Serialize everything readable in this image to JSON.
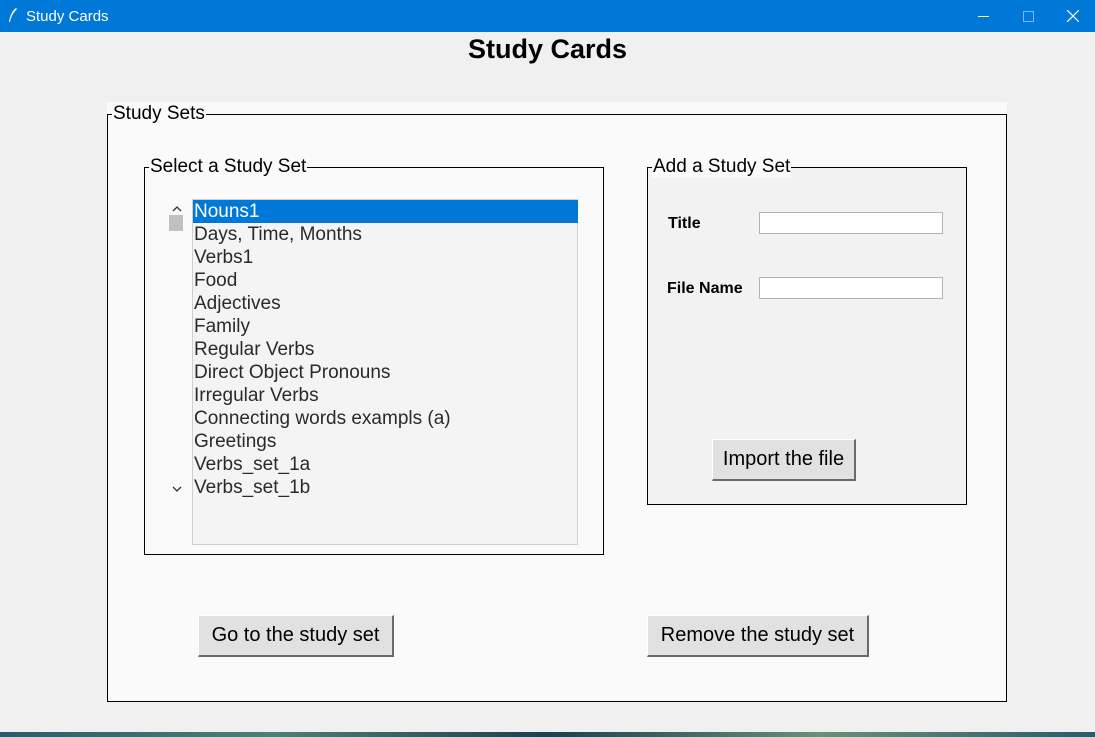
{
  "window": {
    "title": "Study Cards"
  },
  "heading": "Study Cards",
  "study_sets": {
    "legend": "Study Sets",
    "select": {
      "legend": "Select a Study Set",
      "items": [
        "Nouns1",
        "Days, Time, Months",
        "Verbs1",
        "Food",
        "Adjectives",
        "Family",
        "Regular Verbs",
        "Direct Object Pronouns",
        "Irregular Verbs",
        "Connecting words exampls (a)",
        "Greetings",
        "Verbs_set_1a",
        "Verbs_set_1b"
      ],
      "selected_item": "Nouns1"
    },
    "add": {
      "legend": "Add a Study Set",
      "title_label": "Title",
      "title_value": "",
      "file_label": "File Name",
      "file_value": "",
      "import_button": "Import the file"
    },
    "go_button": "Go to the study set",
    "remove_button": "Remove the study set"
  },
  "colors": {
    "titlebar": "#0078d7",
    "selection": "#0078d7",
    "window_bg": "#f0f0f0"
  }
}
